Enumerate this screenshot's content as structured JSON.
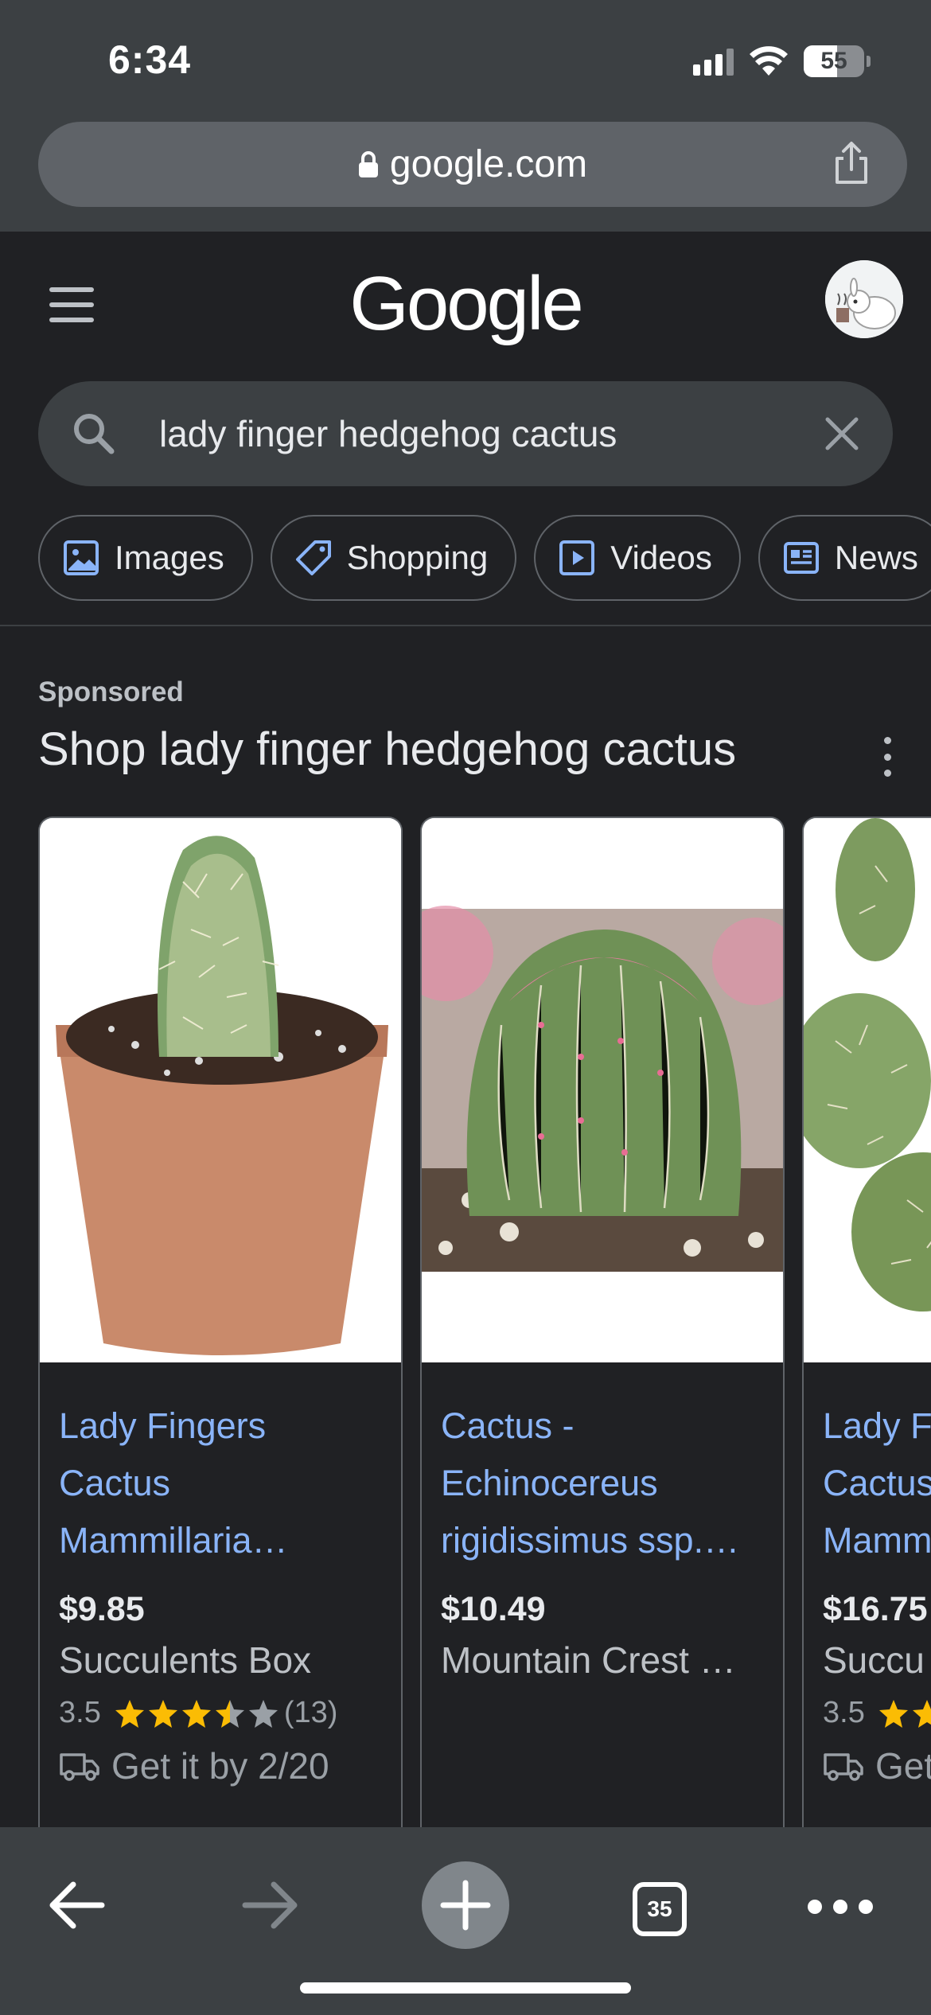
{
  "status_bar": {
    "time": "6:34",
    "battery": "55",
    "battery_fraction": 0.55
  },
  "browser": {
    "url": "google.com",
    "open_tabs_count": "35"
  },
  "google": {
    "logo": "Google",
    "search_query": "lady finger hedgehog cactus",
    "chips": [
      {
        "label": "Images",
        "icon": "image-icon"
      },
      {
        "label": "Shopping",
        "icon": "tag-icon"
      },
      {
        "label": "Videos",
        "icon": "play-icon"
      },
      {
        "label": "News",
        "icon": "news-icon"
      }
    ]
  },
  "shopping": {
    "sponsored_label": "Sponsored",
    "title": "Shop lady finger hedgehog cactus",
    "products": [
      {
        "title_lines": [
          "Lady Fingers",
          "Cactus",
          "Mammillaria…"
        ],
        "price": "$9.85",
        "merchant": "Succulents Box",
        "rating": "3.5",
        "stars": 3.5,
        "reviews": "(13)",
        "delivery": "Get it by 2/20"
      },
      {
        "title_lines": [
          "Cactus -",
          "Echinocereus",
          "rigidissimus ssp.…"
        ],
        "price": "$10.49",
        "merchant": "Mountain Crest …"
      },
      {
        "title_lines": [
          "Lady F",
          "Cactus",
          "Mamm"
        ],
        "price": "$16.75",
        "merchant": "Succu",
        "rating": "3.5",
        "stars": 3.5,
        "delivery": "Get"
      }
    ]
  },
  "colors": {
    "background": "#202124",
    "chrome": "#3c4043",
    "link": "#8ab4f8",
    "star": "#fbbc04"
  }
}
